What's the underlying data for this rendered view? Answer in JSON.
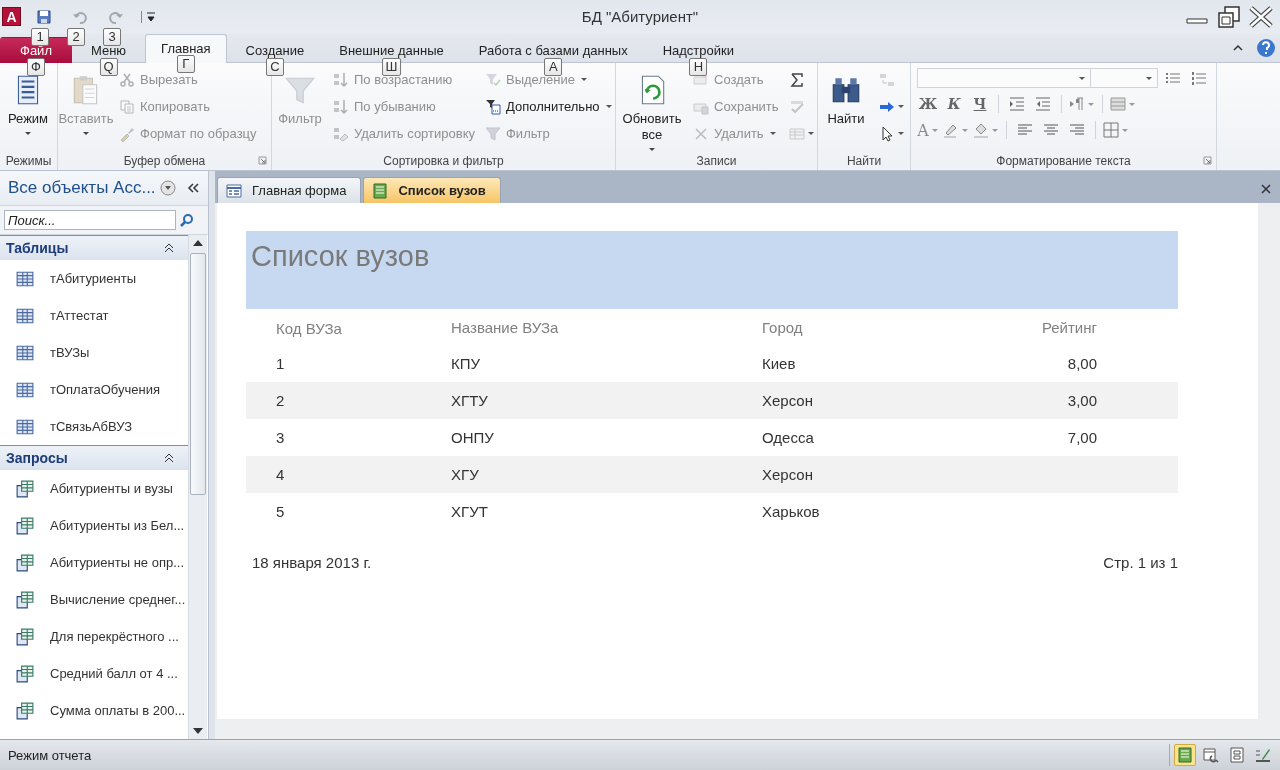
{
  "window": {
    "app_logo": "A",
    "title": "БД \"Абитуриент\""
  },
  "quick_access": [
    {
      "kind": "save",
      "keytip": "1",
      "disabled": false
    },
    {
      "kind": "undo",
      "keytip": "2",
      "disabled": true
    },
    {
      "kind": "redo",
      "keytip": "3",
      "disabled": true
    }
  ],
  "ribbon_tabs": [
    {
      "label": "Файл",
      "kind": "file",
      "selected": false,
      "keytip": "Ф"
    },
    {
      "label": "Меню",
      "kind": "normal",
      "selected": false,
      "keytip": "Q"
    },
    {
      "label": "Главная",
      "kind": "normal",
      "selected": true,
      "keytip": "Г"
    },
    {
      "label": "Создание",
      "kind": "normal",
      "selected": false,
      "keytip": "С"
    },
    {
      "label": "Внешние данные",
      "kind": "normal",
      "selected": false,
      "keytip": "Ш"
    },
    {
      "label": "Работа с базами данных",
      "kind": "normal",
      "selected": false,
      "keytip": "А"
    },
    {
      "label": "Надстройки",
      "kind": "normal",
      "selected": false,
      "keytip": "Н"
    }
  ],
  "ribbon_groups": [
    {
      "label": "Режимы",
      "kind": "buttons",
      "launcher": false,
      "columns": [
        [
          {
            "label": "Режим",
            "kind": "large",
            "dropdown": true,
            "disabled": false
          }
        ]
      ]
    },
    {
      "label": "Буфер обмена",
      "kind": "buttons",
      "launcher": true,
      "columns": [
        [
          {
            "label": "Вставить",
            "kind": "large",
            "dropdown": true,
            "disabled": true
          }
        ],
        [
          {
            "label": "Вырезать",
            "kind": "small",
            "dropdown": false,
            "disabled": true
          },
          {
            "label": "Копировать",
            "kind": "small",
            "dropdown": false,
            "disabled": true
          },
          {
            "label": "Формат по образцу",
            "kind": "small",
            "dropdown": false,
            "disabled": true
          }
        ]
      ]
    },
    {
      "label": "Сортировка и фильтр",
      "kind": "buttons",
      "launcher": false,
      "columns": [
        [
          {
            "label": "Фильтр",
            "kind": "large",
            "dropdown": false,
            "disabled": true
          }
        ],
        [
          {
            "label": "По возрастанию",
            "kind": "small",
            "dropdown": false,
            "disabled": true
          },
          {
            "label": "По убыванию",
            "kind": "small",
            "dropdown": false,
            "disabled": true
          },
          {
            "label": "Удалить сортировку",
            "kind": "small",
            "dropdown": false,
            "disabled": true
          }
        ],
        [
          {
            "label": "Выделение",
            "kind": "small",
            "dropdown": true,
            "disabled": true
          },
          {
            "label": "Дополнительно",
            "kind": "small",
            "dropdown": true,
            "disabled": false
          },
          {
            "label": "Фильтр",
            "kind": "small",
            "dropdown": false,
            "disabled": true
          }
        ]
      ]
    },
    {
      "label": "Записи",
      "kind": "buttons",
      "launcher": false,
      "columns": [
        [
          {
            "label": "Обновить все",
            "kind": "large",
            "dropdown": true,
            "disabled": false
          }
        ],
        [
          {
            "label": "Создать",
            "kind": "small",
            "dropdown": false,
            "disabled": true
          },
          {
            "label": "Сохранить",
            "kind": "small",
            "dropdown": false,
            "disabled": true
          },
          {
            "label": "Удалить",
            "kind": "small",
            "dropdown": true,
            "disabled": true
          }
        ],
        [
          {
            "kind": "icon",
            "dropdown": false,
            "disabled": false
          },
          {
            "kind": "icon",
            "dropdown": false,
            "disabled": true
          },
          {
            "kind": "icon",
            "dropdown": true,
            "disabled": true
          }
        ]
      ]
    },
    {
      "label": "Найти",
      "kind": "buttons",
      "launcher": false,
      "columns": [
        [
          {
            "label": "Найти",
            "kind": "large",
            "dropdown": false,
            "disabled": false
          }
        ],
        [
          {
            "kind": "icon",
            "dropdown": false,
            "disabled": true
          },
          {
            "kind": "icon",
            "dropdown": true,
            "disabled": false
          },
          {
            "kind": "icon",
            "dropdown": true,
            "disabled": false
          }
        ]
      ]
    },
    {
      "label": "Форматирование текста",
      "kind": "format",
      "launcher": true,
      "rows": [
        [
          {
            "kind": "font-field"
          },
          {
            "kind": "size-field"
          },
          {
            "kind": "bullets",
            "dropdown": false
          },
          {
            "kind": "numbering",
            "dropdown": false
          }
        ],
        [
          {
            "kind": "bold",
            "label": "Ж",
            "dropdown": false
          },
          {
            "kind": "italic",
            "label": "К",
            "dropdown": false
          },
          {
            "kind": "underline",
            "label": "Ч",
            "dropdown": false
          },
          {
            "kind": "indent",
            "dropdown": false
          },
          {
            "kind": "outdent",
            "dropdown": false
          },
          {
            "kind": "ltr",
            "dropdown": true
          },
          {
            "kind": "gridlines",
            "dropdown": true
          }
        ],
        [
          {
            "kind": "font-color",
            "label": "A",
            "dropdown": true
          },
          {
            "kind": "highlight",
            "dropdown": true
          },
          {
            "kind": "fill",
            "dropdown": true
          },
          {
            "kind": "align-left",
            "dropdown": false
          },
          {
            "kind": "align-center",
            "dropdown": false
          },
          {
            "kind": "align-right",
            "dropdown": false
          },
          {
            "kind": "borders",
            "dropdown": true
          }
        ]
      ]
    }
  ],
  "navigation": {
    "title": "Все объекты Acc...",
    "search": {
      "placeholder": "Поиск..."
    },
    "sections": [
      {
        "label": "Таблицы",
        "kind": "table",
        "expanded": true,
        "items": [
          "тАбитуриенты",
          "тАттестат",
          "тВУЗы",
          "тОплатаОбучения",
          "тСвязьАбВУЗ"
        ]
      },
      {
        "label": "Запросы",
        "kind": "query",
        "expanded": true,
        "items": [
          "Абитуриенты и вузы",
          "Абитуриенты из Бел...",
          "Абитуриенты не опр...",
          "Вычисление среднег...",
          "Для перекрёстного ...",
          "Средний балл от 4 ...",
          "Сумма оплаты в 200..."
        ]
      }
    ]
  },
  "document_tabs": [
    {
      "label": "Главная форма",
      "kind": "form",
      "selected": false
    },
    {
      "label": "Список вузов",
      "kind": "report",
      "selected": true
    }
  ],
  "report": {
    "title": "Список вузов",
    "columns": [
      "Код ВУЗа",
      "Название ВУЗа",
      "Город",
      "Рейтинг"
    ],
    "rows": [
      [
        "1",
        "КПУ",
        "Киев",
        "8,00"
      ],
      [
        "2",
        "ХГТУ",
        "Херсон",
        "3,00"
      ],
      [
        "3",
        "ОНПУ",
        "Одесса",
        "7,00"
      ],
      [
        "4",
        "ХГУ",
        "Херсон",
        ""
      ],
      [
        "5",
        "ХГУТ",
        "Харьков",
        ""
      ]
    ],
    "date": "18 января 2013 г.",
    "page": "Стр. 1 из 1"
  },
  "status_bar": {
    "text": "Режим отчета",
    "views": [
      {
        "kind": "report",
        "selected": true
      },
      {
        "kind": "print-preview",
        "selected": false
      },
      {
        "kind": "layout",
        "selected": false
      },
      {
        "kind": "design",
        "selected": false
      }
    ]
  }
}
